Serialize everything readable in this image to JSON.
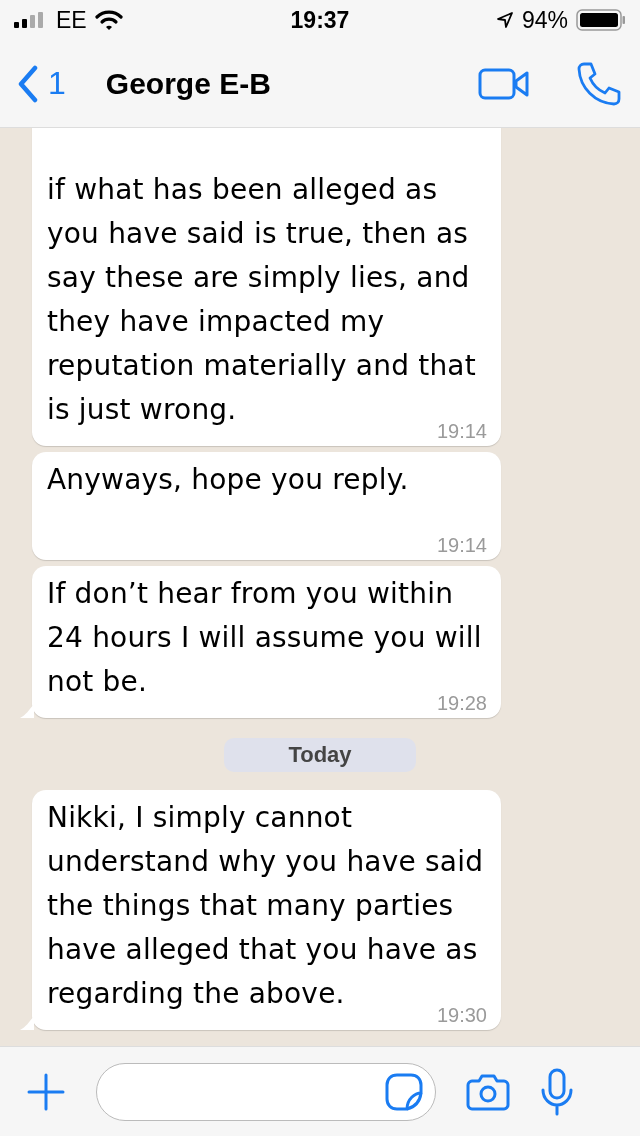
{
  "status_bar": {
    "carrier": "EE",
    "time": "19:37",
    "battery": "94%"
  },
  "header": {
    "back_count": "1",
    "contact": "George E-B"
  },
  "messages": [
    {
      "kind": "message",
      "text": "if what has been alleged as you have said is true, then as say these are simply lies, and they have impacted my reputation materially and that is just wrong.",
      "time": "19:14",
      "cut_top": true,
      "tail": false
    },
    {
      "kind": "message",
      "text": "Anyways, hope you reply.",
      "time": "19:14",
      "cut_top": false,
      "tail": false
    },
    {
      "kind": "message",
      "text": "If don’t hear from you within 24 hours I will assume you will not be.",
      "time": "19:28",
      "cut_top": false,
      "tail": true
    },
    {
      "kind": "date",
      "text": "Today"
    },
    {
      "kind": "message",
      "text": "Nikki, I simply cannot understand why you have said the things that many parties have alleged that you have as regarding the above.",
      "time": "19:30",
      "cut_top": false,
      "tail": true
    }
  ]
}
